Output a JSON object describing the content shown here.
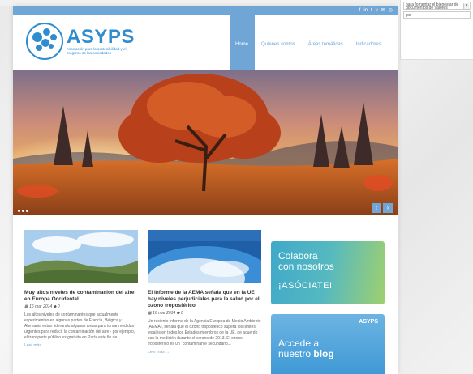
{
  "side_widget": {
    "select_text": "para fomentar el bienestar de documentos de valores",
    "input_value": "ips"
  },
  "social_icons": [
    "f",
    "in",
    "t",
    "v",
    "✉",
    "◎"
  ],
  "logo": {
    "title": "ASYPS",
    "subtitle": "Asociación para la sostenibilidad y el progreso de las sociedades"
  },
  "nav": [
    {
      "label": "Home",
      "active": true
    },
    {
      "label": "Quienes somos",
      "active": false
    },
    {
      "label": "Áreas temáticas",
      "active": false
    },
    {
      "label": "Indicadores",
      "active": false
    }
  ],
  "hero": {
    "nav_prev": "‹",
    "nav_next": "›"
  },
  "articles": [
    {
      "title": "Muy altos niveles de contaminación del aire en Europa Occidental",
      "date": "16 mar 2014",
      "comments": "0",
      "excerpt": "Los altos niveles de contaminantes que actualmente experimentan en algunas partes de Francia, Bélgica y Alemania están liderando algunas áreas para tomar medidas urgentes para reducir la contaminación del aire - por ejemplo, el transporte público es gratuito en París este fin de...",
      "more": "Leer más →"
    },
    {
      "title": "El informe de la AEMA señala que en la UE hay niveles perjudiciales para la salud por el ozono troposférico",
      "date": "16 mar 2014",
      "comments": "0",
      "excerpt": "Un reciente informe de la Agencia Europea de Medio Ambiente (AEMA), señala que el ozono troposférico supera los límites legales en todos los Estados miembros de la UE, de acuerdo con la medición durante el verano de 2013. El ozono troposférico es un \"contaminante secundario...",
      "more": "Leer más →"
    }
  ],
  "banners": {
    "collaborate_line1": "Colabora",
    "collaborate_line2": "con nosotros",
    "collaborate_cta": "¡ASÓCIATE!",
    "blog_line1": "Accede a",
    "blog_line2": "nuestro",
    "blog_bold": "blog",
    "blog_logo": "ASYPS"
  },
  "colors": {
    "brand": "#2f8ccf",
    "nav_accent": "#6fa6d6"
  }
}
